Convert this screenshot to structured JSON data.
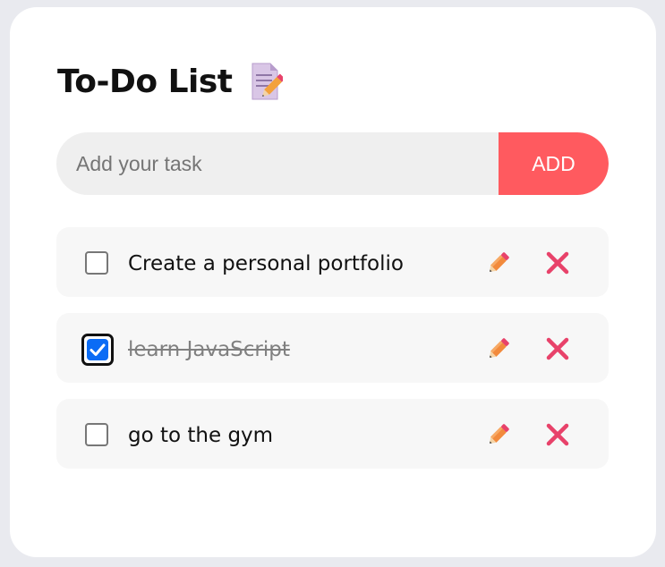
{
  "app": {
    "title": "To-Do List",
    "title_icon": "memo-icon"
  },
  "input": {
    "placeholder": "Add your task",
    "value": "",
    "add_label": "ADD"
  },
  "tasks": [
    {
      "text": "Create a personal portfolio",
      "completed": false
    },
    {
      "text": "learn JavaScript",
      "completed": true
    },
    {
      "text": "go to the gym",
      "completed": false
    }
  ],
  "icons": {
    "edit": "pencil-icon",
    "delete": "cross-icon"
  },
  "colors": {
    "accent": "#ff5a5f",
    "checkbox_checked": "#0b6cf5",
    "delete_icon": "#e8426a",
    "edit_icon": "#f28a3c"
  }
}
